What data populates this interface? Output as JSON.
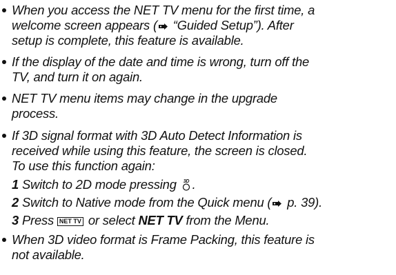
{
  "bullets": [
    {
      "lines": [
        "When you access the NET TV menu for the first time, a",
        "welcome screen appears (",
        " “Guided Setup”). After",
        "setup is complete, this feature is available."
      ]
    },
    {
      "lines": [
        "If the display of the date and time is wrong, turn off the",
        "TV, and turn it on again."
      ]
    },
    {
      "lines": [
        "NET TV menu items may change in the upgrade",
        "process."
      ]
    },
    {
      "lines": [
        "If 3D signal format with 3D Auto Detect Information is",
        "received while using this feature, the screen is closed.",
        "To use this function again:"
      ],
      "steps": [
        {
          "num": "1",
          "text_before": "Switch to 2D mode pressing",
          "icon": "3d-button-icon",
          "text_after": "."
        },
        {
          "num": "2",
          "text_before": "Switch to Native mode from the Quick menu (",
          "icon": "reference-hand-icon",
          "text_after": " p. 39)."
        },
        {
          "num": "3",
          "text_before": "Press",
          "key_label": "NET TV",
          "text_mid": " or select ",
          "bold": "NET TV",
          "text_after": " from the Menu."
        }
      ]
    },
    {
      "lines": [
        "When 3D video format is Frame Packing, this feature is",
        "not available."
      ]
    }
  ],
  "icons": {
    "reference": "reference-hand-icon",
    "button_3d": "3d-button-icon",
    "bullet": "bullet-dot"
  },
  "colors": {
    "text": "#111111",
    "background": "#ffffff"
  }
}
